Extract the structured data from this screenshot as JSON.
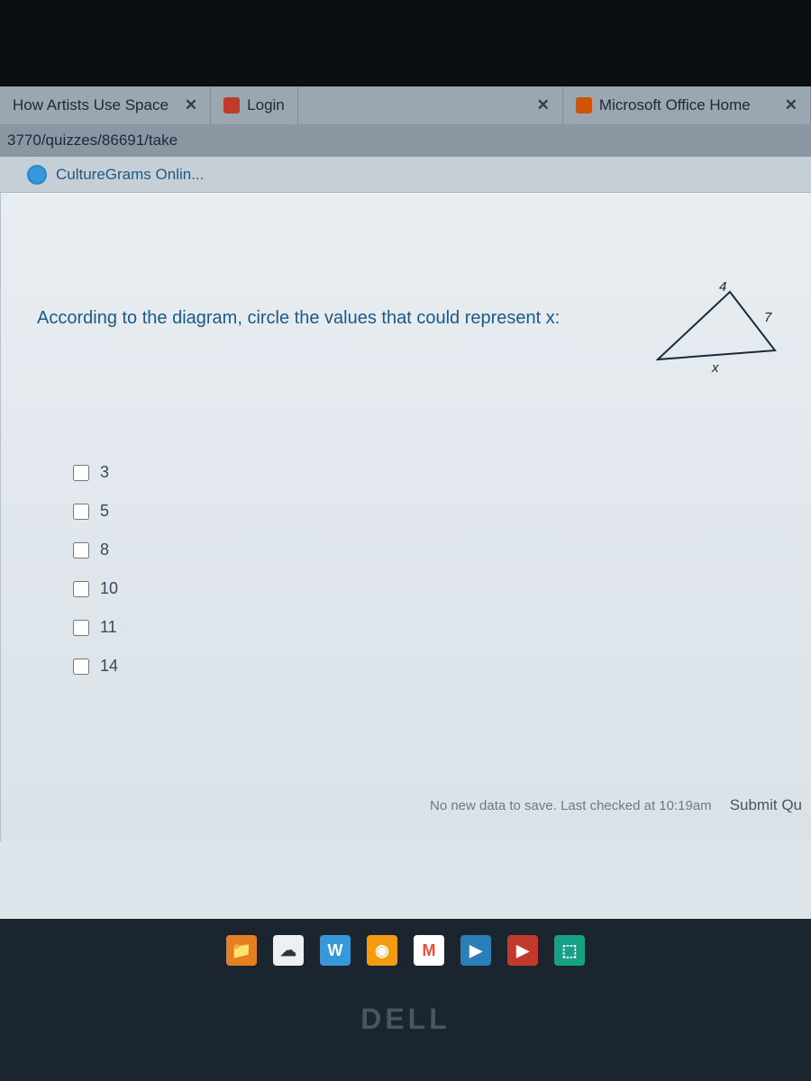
{
  "tabs": [
    {
      "label": "How Artists Use Space",
      "favicon": "generic"
    },
    {
      "label": "Login",
      "favicon": "red"
    },
    {
      "label": "Microsoft Office Home",
      "favicon": "ms"
    }
  ],
  "url": "3770/quizzes/86691/take",
  "bookmark": {
    "label": "CultureGrams Onlin..."
  },
  "question": {
    "text": "According to the diagram, circle the values that could represent x:",
    "triangle": {
      "top": "4",
      "right": "7",
      "bottom": "x"
    }
  },
  "options": [
    {
      "label": "3"
    },
    {
      "label": "5"
    },
    {
      "label": "8"
    },
    {
      "label": "10"
    },
    {
      "label": "11"
    },
    {
      "label": "14"
    }
  ],
  "save_status": "No new data to save. Last checked at 10:19am",
  "submit_label": "Submit Qu",
  "brand": "DELL"
}
